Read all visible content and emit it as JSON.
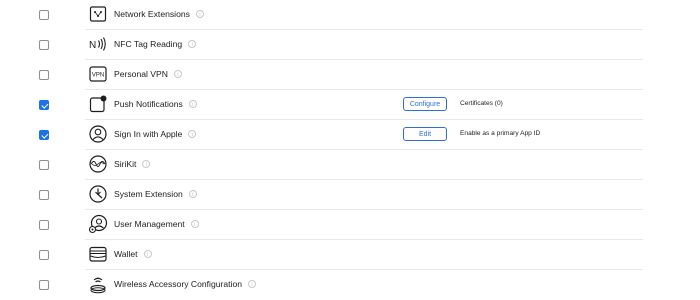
{
  "capabilities": [
    {
      "name": "Network Extensions",
      "checked": false,
      "icon": "network-extensions-icon"
    },
    {
      "name": "NFC Tag Reading",
      "checked": false,
      "icon": "nfc-icon"
    },
    {
      "name": "Personal VPN",
      "checked": false,
      "icon": "vpn-icon"
    },
    {
      "name": "Push Notifications",
      "checked": true,
      "icon": "push-notifications-icon",
      "button": "Configure",
      "detail": "Certificates (0)"
    },
    {
      "name": "Sign In with Apple",
      "checked": true,
      "icon": "sign-in-apple-icon",
      "button": "Edit",
      "detail": "Enable as a primary App ID"
    },
    {
      "name": "SiriKit",
      "checked": false,
      "icon": "sirikit-icon"
    },
    {
      "name": "System Extension",
      "checked": false,
      "icon": "system-extension-icon"
    },
    {
      "name": "User Management",
      "checked": false,
      "icon": "user-management-icon"
    },
    {
      "name": "Wallet",
      "checked": false,
      "icon": "wallet-icon"
    },
    {
      "name": "Wireless Accessory Configuration",
      "checked": false,
      "icon": "wireless-accessory-icon"
    }
  ],
  "colors": {
    "accent": "#1a73e8",
    "button": "#2e6fd6",
    "divider": "#e8e8ea"
  }
}
